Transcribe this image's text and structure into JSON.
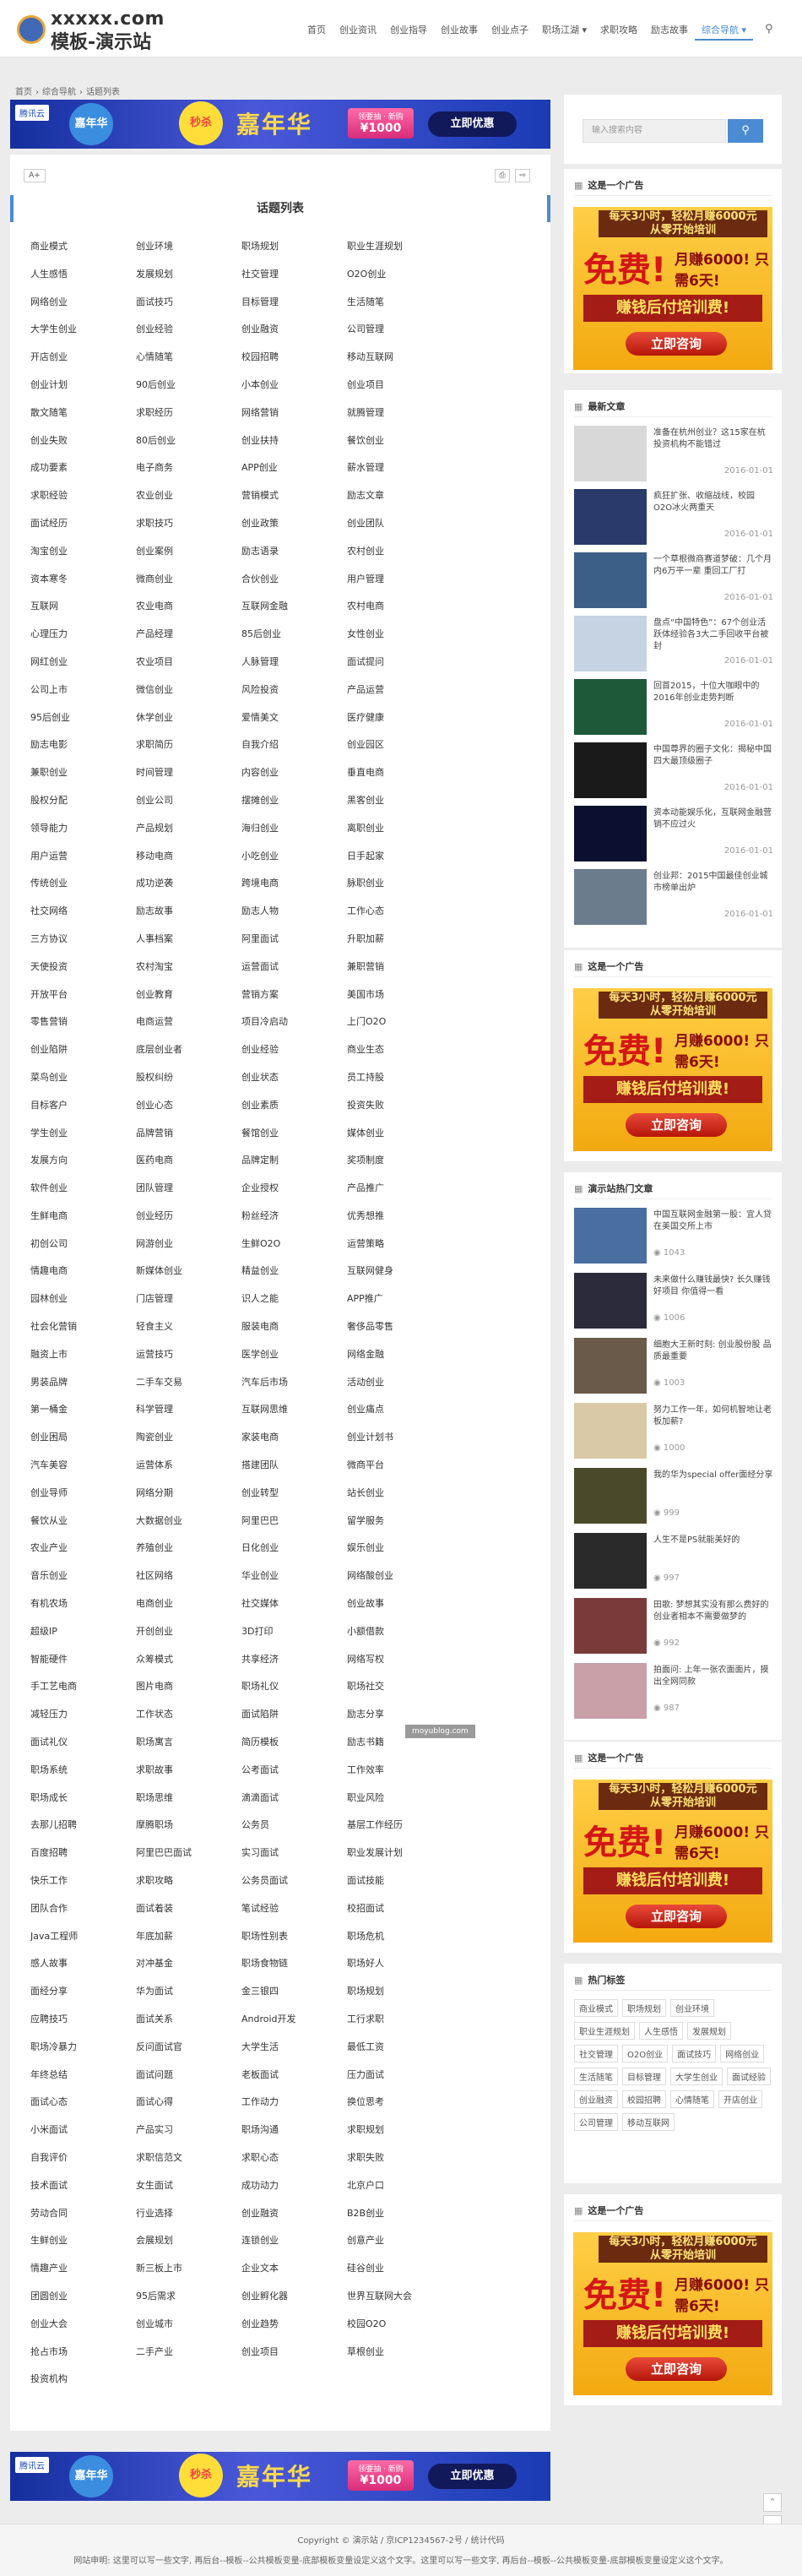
{
  "header": {
    "logo_line1": "xxxxx.com",
    "logo_line2": "模板-演示站",
    "nav": [
      "首页",
      "创业资讯",
      "创业指导",
      "创业故事",
      "创业点子",
      "职场江湖 ▾",
      "求职攻略",
      "励志故事",
      "综合导航 ▾"
    ],
    "search_icon": "search-icon"
  },
  "breadcrumb": [
    "首页",
    "›",
    "综合导航",
    "›",
    "话题列表"
  ],
  "banner": {
    "brand": "腾讯云",
    "circle1": "嘉年华",
    "circle2": "秒杀",
    "big": "嘉年华",
    "pill_top": "领要抽 · 新购",
    "pill_amount": "¥1000",
    "button": "立即优惠"
  },
  "toolbar": {
    "font": "A+",
    "print": "⎙",
    "share": "⇨"
  },
  "main": {
    "title": "话题列表",
    "tags": [
      "商业模式",
      "创业环境",
      "职场规划",
      "职业生涯规划",
      "人生感悟",
      "发展规划",
      "社交管理",
      "O2O创业",
      "网络创业",
      "面试技巧",
      "目标管理",
      "生活随笔",
      "大学生创业",
      "创业经验",
      "创业融资",
      "公司管理",
      "开店创业",
      "心情随笔",
      "校园招聘",
      "移动互联网",
      "创业计划",
      "90后创业",
      "小本创业",
      "创业项目",
      "散文随笔",
      "求职经历",
      "网络营销",
      "就腾管理",
      "创业失败",
      "80后创业",
      "创业扶持",
      "餐饮创业",
      "成功要素",
      "电子商务",
      "APP创业",
      "薪水管理",
      "求职经验",
      "农业创业",
      "营销模式",
      "励志文章",
      "面试经历",
      "求职技巧",
      "创业政策",
      "创业团队",
      "淘宝创业",
      "创业案例",
      "励志语录",
      "农村创业",
      "资本寒冬",
      "微商创业",
      "合伙创业",
      "用户管理",
      "互联网",
      "农业电商",
      "互联网金融",
      "农村电商",
      "心理压力",
      "产品经理",
      "85后创业",
      "女性创业",
      "网红创业",
      "农业项目",
      "人脉管理",
      "面试提问",
      "公司上市",
      "微信创业",
      "风险投资",
      "产品运营",
      "95后创业",
      "休学创业",
      "爱情美文",
      "医疗健康",
      "励志电影",
      "求职简历",
      "自我介绍",
      "创业园区",
      "兼职创业",
      "时间管理",
      "内容创业",
      "垂直电商",
      "股权分配",
      "创业公司",
      "摆摊创业",
      "黑客创业",
      "领导能力",
      "产品规划",
      "海归创业",
      "离职创业",
      "用户运营",
      "移动电商",
      "小吃创业",
      "日手起家",
      "传统创业",
      "成功逆袭",
      "跨境电商",
      "脉职创业",
      "社交网络",
      "励志故事",
      "励志人物",
      "工作心态",
      "三方协议",
      "人事档案",
      "阿里面试",
      "升职加薪",
      "天使投资",
      "农村淘宝",
      "运营面试",
      "兼职营销",
      "开放平台",
      "创业教育",
      "营销方案",
      "美国市场",
      "零售营销",
      "电商运营",
      "项目冷启动",
      "上门O2O",
      "创业陷阱",
      "底层创业者",
      "创业经验",
      "商业生态",
      "菜鸟创业",
      "股权纠纷",
      "创业状态",
      "员工持股",
      "目标客户",
      "创业心态",
      "创业素质",
      "投资失败",
      "学生创业",
      "品牌营销",
      "餐馆创业",
      "媒体创业",
      "发展方向",
      "医药电商",
      "品牌定制",
      "奖项制度",
      "软件创业",
      "团队管理",
      "企业授权",
      "产品推广",
      "生鲜电商",
      "创业经历",
      "粉丝经济",
      "优秀想推",
      "初创公司",
      "网游创业",
      "生鲜O2O",
      "运营策略",
      "情趣电商",
      "新媒体创业",
      "精益创业",
      "互联网健身",
      "园林创业",
      "门店管理",
      "识人之能",
      "APP推广",
      "社会化营销",
      "轻食主义",
      "服装电商",
      "奢侈品零售",
      "融资上市",
      "运营技巧",
      "医学创业",
      "网络金融",
      "男装品牌",
      "二手车交易",
      "汽车后市场",
      "活动创业",
      "第一桶金",
      "科学管理",
      "互联网思维",
      "创业痛点",
      "创业困局",
      "陶瓷创业",
      "家装电商",
      "创业计划书",
      "汽车美容",
      "运营体系",
      "搭建团队",
      "微商平台",
      "创业导师",
      "网络分期",
      "创业转型",
      "站长创业",
      "餐饮从业",
      "大数据创业",
      "阿里巴巴",
      "留学服务",
      "农业产业",
      "养殖创业",
      "日化创业",
      "娱乐创业",
      "音乐创业",
      "社区网络",
      "华业创业",
      "网络酸创业",
      "有机农场",
      "电商创业",
      "社交媒体",
      "创业故事",
      "超级IP",
      "开创创业",
      "3D打印",
      "小额借款",
      "智能硬件",
      "众筹模式",
      "共享经济",
      "网络写权",
      "手工艺电商",
      "图片电商",
      "职场礼仪",
      "职场社交",
      "减轻压力",
      "工作状态",
      "面试陷阱",
      "励志分享",
      "面试礼仪",
      "职场寓言",
      "简历模板",
      "励志书籍",
      "职场系统",
      "求职故事",
      "公考面试",
      "工作效率",
      "职场成长",
      "职场思维",
      "滴滴面试",
      "职业风险",
      "去那儿招聘",
      "摩腾职场",
      "公务员",
      "基层工作经历",
      "百度招聘",
      "阿里巴巴面试",
      "实习面试",
      "职业发展计划",
      "快乐工作",
      "求职攻略",
      "公务员面试",
      "面试技能",
      "团队合作",
      "面试着装",
      "笔试经验",
      "校招面试",
      "Java工程师",
      "年底加薪",
      "职场性别表",
      "职场危机",
      "感人故事",
      "对冲基金",
      "职场食物链",
      "职场好人",
      "面经分享",
      "华为面试",
      "金三银四",
      "职场规划",
      "应聘技巧",
      "面试关系",
      "Android开发",
      "工行求职",
      "职场冷暴力",
      "反问面试官",
      "大学生活",
      "最低工资",
      "年终总结",
      "面试问题",
      "老板面试",
      "压力面试",
      "面试心态",
      "面试心得",
      "工作动力",
      "换位思考",
      "小米面试",
      "产品实习",
      "职场沟通",
      "求职规划",
      "自我评价",
      "求职信范文",
      "求职心态",
      "求职失败",
      "技术面试",
      "女生面试",
      "成功动力",
      "北京户口",
      "劳动合同",
      "行业选择",
      "创业融资",
      "B2B创业",
      "生鲜创业",
      "会展规划",
      "连锁创业",
      "创意产业",
      "情趣产业",
      "新三板上市",
      "企业文本",
      "硅谷创业",
      "团圆创业",
      "95后需求",
      "创业孵化器",
      "世界互联网大会",
      "创业大会",
      "创业城市",
      "创业趋势",
      "校园O2O",
      "抢占市场",
      "二手产业",
      "创业项目",
      "草根创业",
      "投资机构"
    ]
  },
  "sidebar": {
    "search_placeholder": "输入搜索内容",
    "ad_title": "这是一个广告",
    "ad": {
      "top1": "每天3小时，轻松月赚6000元",
      "top2": "从零开始培训",
      "big": "免费!",
      "mid": "月赚6000! 只需6天!",
      "strip": "赚钱后付培训费!",
      "btn": "立即咨询"
    },
    "latest_title": "最新文章",
    "latest": [
      {
        "title": "准备在杭州创业？这15家在杭投资机构不能错过",
        "date": "2016-01-01"
      },
      {
        "title": "疯狂扩张、收缩战线，校园O2O冰火两重天",
        "date": "2016-01-01"
      },
      {
        "title": "一个草根微商赛道梦破：几个月内6万平一辈 重回工厂打",
        "date": "2016-01-01"
      },
      {
        "title": "盘点“中国特色”：67个创业活跃体经验各3大二手回收平台被封",
        "date": "2016-01-01"
      },
      {
        "title": "回首2015，十位大咖眼中的2016年创业走势判断",
        "date": "2016-01-01"
      },
      {
        "title": "中国尊界的圈子文化：揭秘中国四大最顶级圈子",
        "date": "2016-01-01"
      },
      {
        "title": "资本动能娱乐化，互联网金融营销不应过火",
        "date": "2016-01-01"
      },
      {
        "title": "创业邦：2015中国最佳创业城市榜单出炉",
        "date": "2016-01-01"
      }
    ],
    "hot_title": "演示站热门文章",
    "hot": [
      {
        "title": "中国互联网金融第一股：宜人贷在美国交所上市",
        "views": "1043"
      },
      {
        "title": "未来做什么赚钱最快? 长久赚钱好项目 你值得一看",
        "views": "1006"
      },
      {
        "title": "细胞大王新时刻: 创业股份股 品质最重要",
        "views": "1003"
      },
      {
        "title": "努力工作一年，如何机智地让老板加薪?",
        "views": "1000"
      },
      {
        "title": "我的华为special offer面经分享",
        "views": "999"
      },
      {
        "title": "人生不是PS就能美好的",
        "views": "997"
      },
      {
        "title": "田歌: 梦想其实没有那么费好的创业者相本不需要做梦的",
        "views": "992"
      },
      {
        "title": "拍面问: 上年一张农面面片，摸出全网同款",
        "views": "987"
      }
    ],
    "tags_title": "热门标签",
    "hot_tags": [
      "商业模式",
      "职场规划",
      "创业环境",
      "职业生涯规划",
      "人生感悟",
      "发展规划",
      "社交管理",
      "O2O创业",
      "面试技巧",
      "网络创业",
      "生活随笔",
      "目标管理",
      "大学生创业",
      "面试经验",
      "创业融资",
      "校园招聘",
      "心情随笔",
      "开店创业",
      "公司管理",
      "移动互联网"
    ]
  },
  "footer": {
    "copyright": "Copyright © 演示站 / 京ICP1234567-2号 / 统计代码",
    "note": "网站申明: 这里可以写一些文字, 再后台--模板--公共模板变量-底部模板变量设定义这个文字。这里可以写一些文字, 再后台--模板--公共模板变量-底部模板变量设定义这个文字。",
    "watermark": "moyublog.com",
    "up": "⌃",
    "down": "⌄"
  },
  "colors": {
    "accent": "#4b8bd1",
    "ad_red": "#d41616"
  }
}
